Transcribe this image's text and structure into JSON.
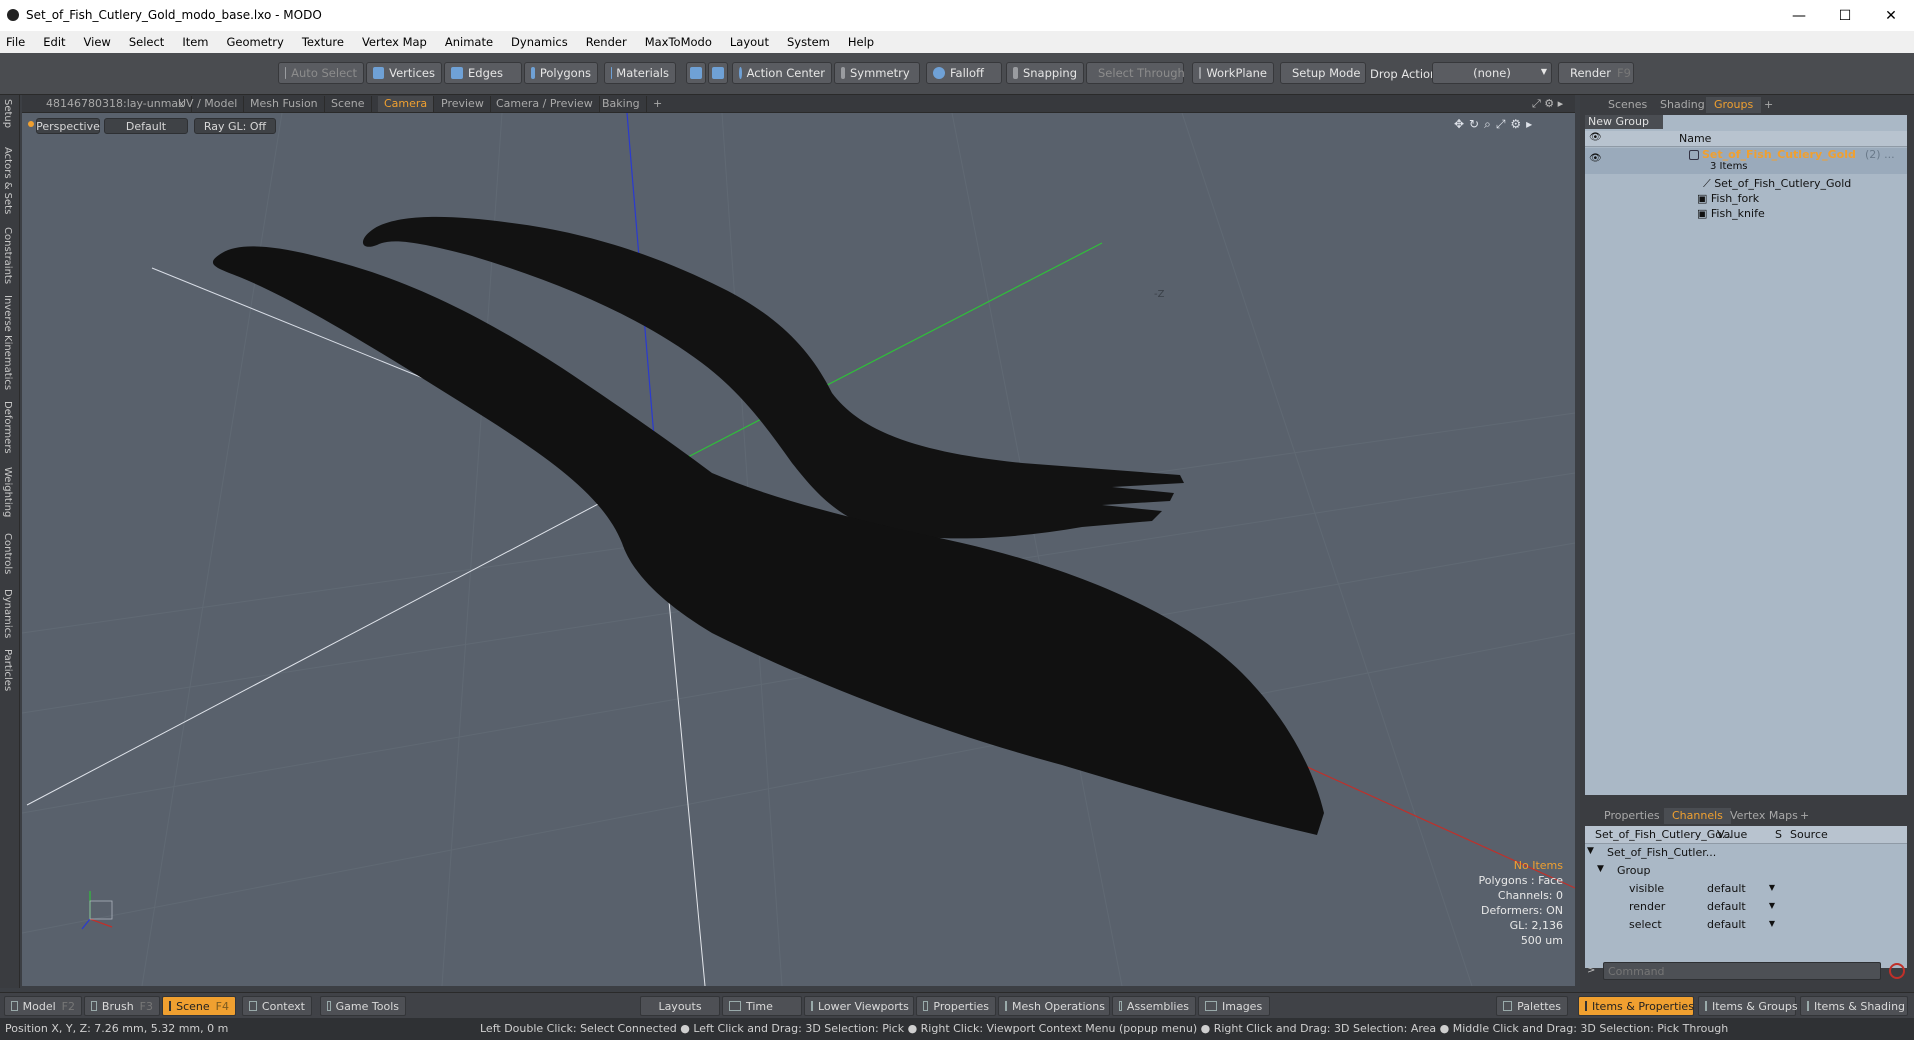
{
  "window": {
    "title": "Set_of_Fish_Cutlery_Gold_modo_base.lxo - MODO",
    "minimize": "—",
    "maximize": "☐",
    "close": "✕"
  },
  "menu": [
    "File",
    "Edit",
    "View",
    "Select",
    "Item",
    "Geometry",
    "Texture",
    "Vertex Map",
    "Animate",
    "Dynamics",
    "Render",
    "MaxToModo",
    "Layout",
    "System",
    "Help"
  ],
  "toolbar": {
    "auto_select": "Auto Select",
    "vertices": "Vertices",
    "edges": "Edges",
    "polygons": "Polygons",
    "materials": "Materials",
    "action_center": "Action Center",
    "symmetry": "Symmetry",
    "falloff": "Falloff",
    "snapping": "Snapping",
    "select_through": "Select Through",
    "workplane": "WorkPlane",
    "setup_mode": "Setup Mode",
    "drop_action_label": "Drop Action",
    "drop_action_value": "(none)",
    "render": "Render",
    "render_key": "F9"
  },
  "left_tabs": [
    "Setup",
    "Actors & Sets",
    "Constraints",
    "Inverse Kinematics",
    "Deformers",
    "Weighting",
    "Controls",
    "Dynamics",
    "Particles"
  ],
  "viewport_tabs": [
    "48146780318:lay-unmax",
    "UV / Model",
    "Mesh Fusion",
    "Scene",
    "Camera",
    "Preview",
    "Camera / Preview",
    "Baking",
    "+"
  ],
  "viewport_active_tab": "Camera",
  "viewport": {
    "perspective": "Perspective",
    "shading": "Default",
    "raygl": "Ray GL: Off",
    "axis_label": "-Z",
    "info": {
      "items": "No Items",
      "polygons": "Polygons : Face",
      "channels": "Channels: 0",
      "deformers": "Deformers: ON",
      "gl": "GL: 2,136",
      "scale": "500 um"
    }
  },
  "right_tabs": [
    "Scenes",
    "Shading",
    "Groups",
    "+"
  ],
  "right_active_tab": "Groups",
  "groups": {
    "new_group": "New Group",
    "name_header": "Name",
    "group_name": "Set_of_Fish_Cutlery_Gold",
    "group_count": "(2) ...",
    "items_count": "3 Items",
    "children": [
      "Set_of_Fish_Cutlery_Gold",
      "Fish_fork",
      "Fish_knife"
    ]
  },
  "bottom_tabs": [
    "Properties",
    "Channels",
    "Vertex Maps",
    "+"
  ],
  "bottom_active_tab": "Channels",
  "channels": {
    "col_name": "Set_of_Fish_Cutlery_Go...",
    "col_value": "Value",
    "col_s": "S",
    "col_source": "Source",
    "root": "Set_of_Fish_Cutler...",
    "group": "Group",
    "rows": [
      {
        "name": "visible",
        "value": "default"
      },
      {
        "name": "render",
        "value": "default"
      },
      {
        "name": "select",
        "value": "default"
      }
    ]
  },
  "command": {
    "placeholder": "Command"
  },
  "bottom_bar": {
    "model": "Model",
    "model_key": "F2",
    "brush": "Brush",
    "brush_key": "F3",
    "scene": "Scene",
    "scene_key": "F4",
    "context": "Context",
    "game_tools": "Game Tools",
    "layouts": "Layouts",
    "time": "Time",
    "lower_viewports": "Lower Viewports",
    "properties": "Properties",
    "mesh_operations": "Mesh Operations",
    "assemblies": "Assemblies",
    "images": "Images",
    "palettes": "Palettes",
    "items_properties": "Items & Properties",
    "items_groups": "Items & Groups",
    "items_shading": "Items & Shading"
  },
  "status": {
    "position": "Position X, Y, Z:  7.26 mm, 5.32 mm, 0 m",
    "hint": "Left Double Click: Select Connected ● Left Click and Drag: 3D Selection: Pick ● Right Click: Viewport Context Menu (popup menu) ● Right Click and Drag: 3D Selection: Area ● Middle Click and Drag: 3D Selection: Pick Through"
  },
  "colors": {
    "accent": "#f0a030",
    "viewport_bg": "#59616c",
    "x_axis": "#c0302a",
    "y_axis": "#2fbf3a",
    "z_axis": "#2a3ad0",
    "mesh": "#121212"
  }
}
